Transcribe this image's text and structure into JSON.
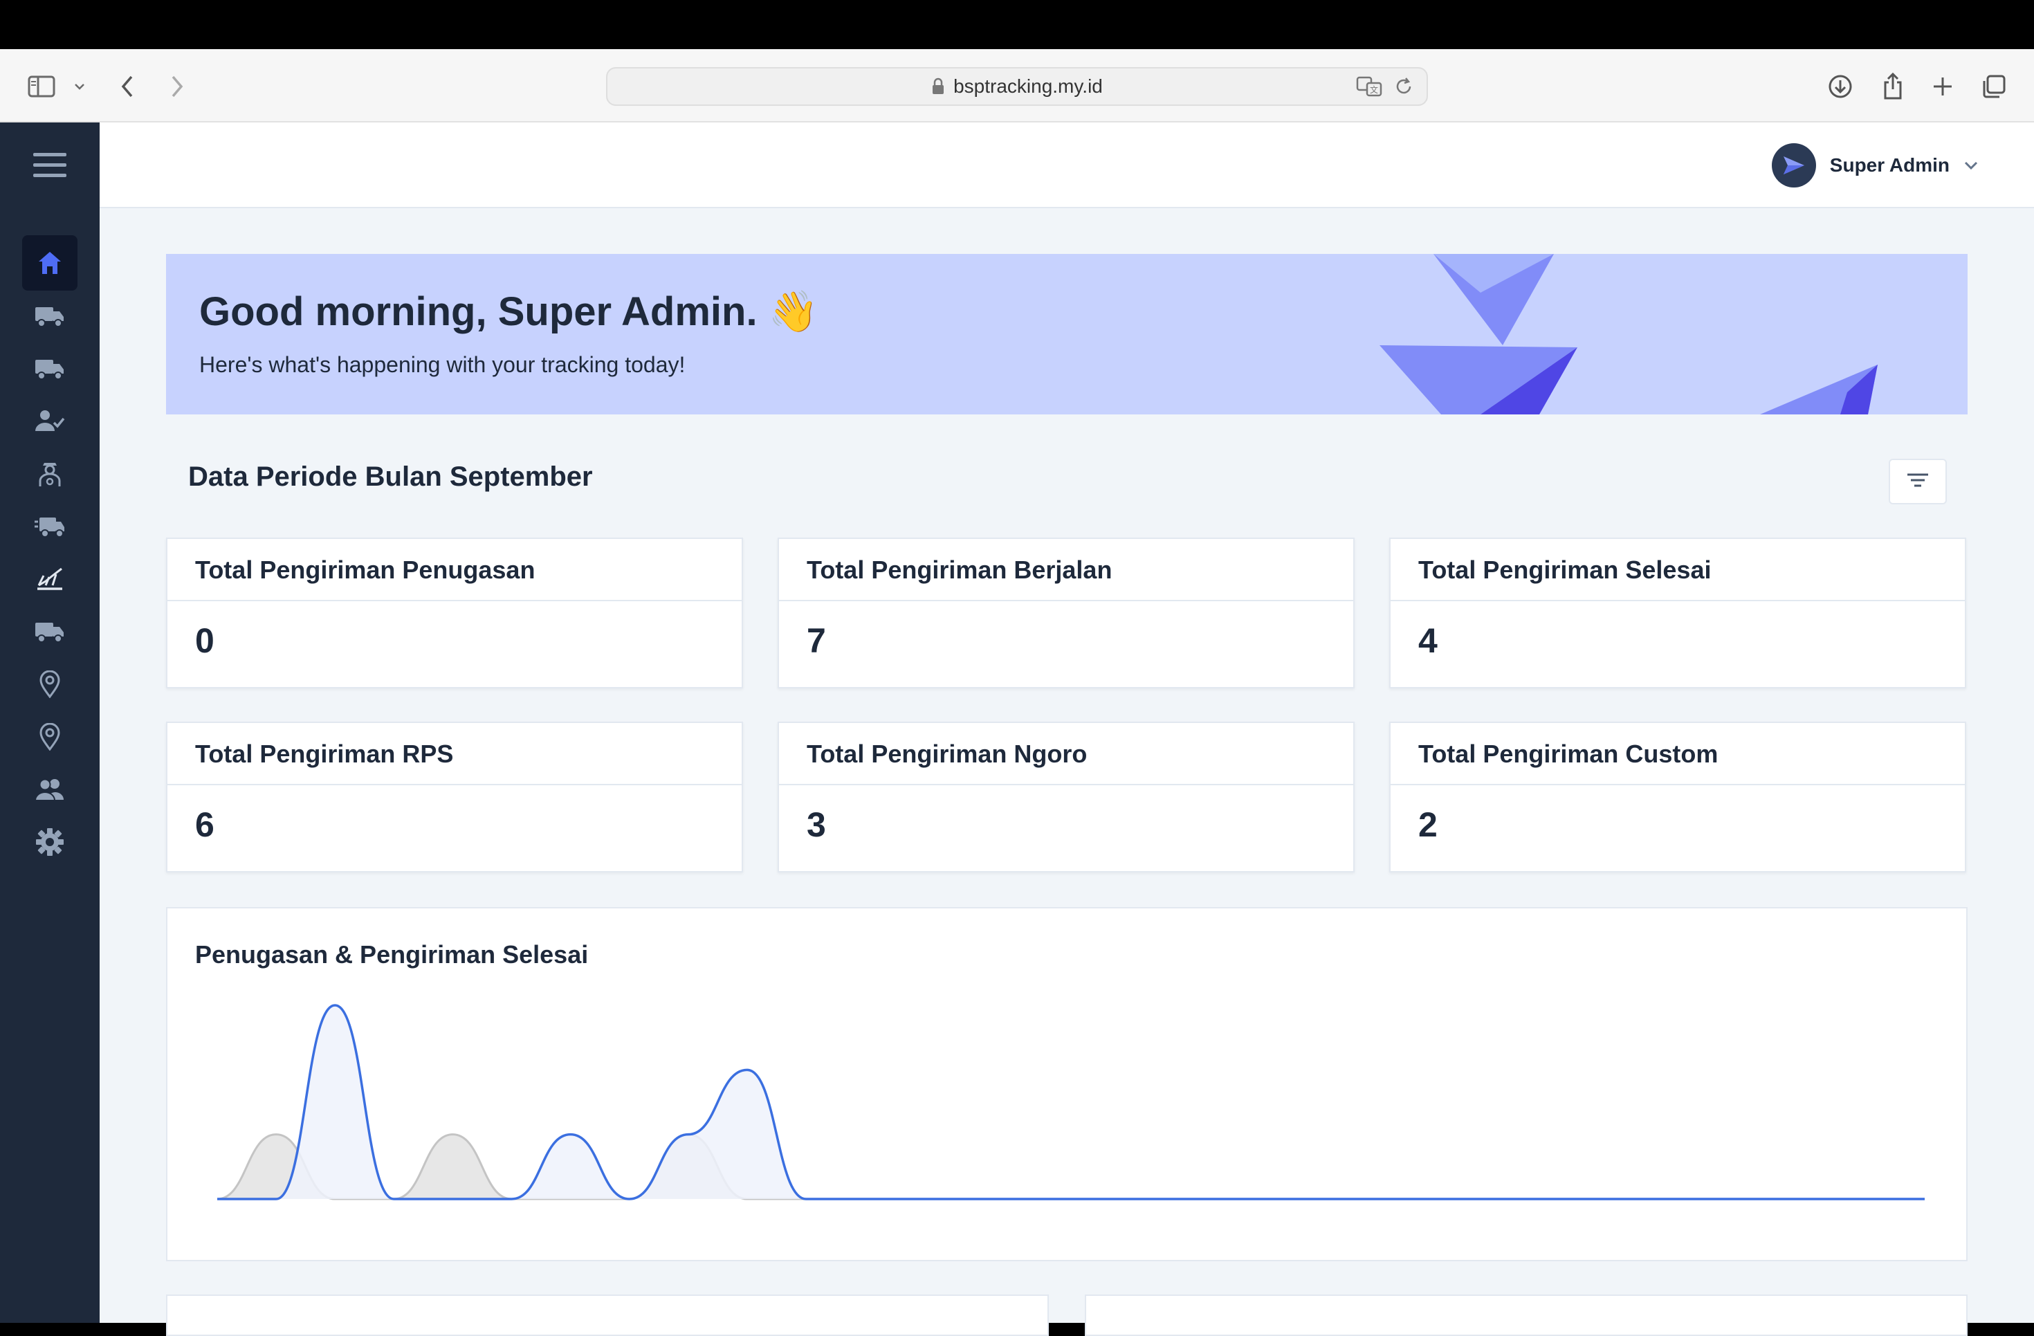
{
  "browser": {
    "url": "bsptracking.my.id"
  },
  "header": {
    "username": "Super Admin"
  },
  "sidebar": {
    "items": [
      {
        "icon": "menu-icon"
      },
      {
        "icon": "home-icon",
        "active": true
      },
      {
        "icon": "truck-icon"
      },
      {
        "icon": "truck-icon"
      },
      {
        "icon": "user-check-icon"
      },
      {
        "icon": "driver-icon"
      },
      {
        "icon": "fast-truck-icon"
      },
      {
        "icon": "chart-icon"
      },
      {
        "icon": "delivery-truck-icon"
      },
      {
        "icon": "location-pin-icon"
      },
      {
        "icon": "location-pin-icon"
      },
      {
        "icon": "users-icon"
      },
      {
        "icon": "gear-icon"
      }
    ]
  },
  "welcome": {
    "greeting": "Good morning, Super Admin. 👋",
    "subtitle": "Here's what's happening with your tracking today!"
  },
  "period": {
    "title": "Data Periode Bulan September"
  },
  "stats": [
    {
      "label": "Total Pengiriman Penugasan",
      "value": "0"
    },
    {
      "label": "Total Pengiriman Berjalan",
      "value": "7"
    },
    {
      "label": "Total Pengiriman Selesai",
      "value": "4"
    },
    {
      "label": "Total Pengiriman RPS",
      "value": "6"
    },
    {
      "label": "Total Pengiriman Ngoro",
      "value": "3"
    },
    {
      "label": "Total Pengiriman Custom",
      "value": "2"
    }
  ],
  "chart": {
    "title": "Penugasan & Pengiriman Selesai"
  },
  "chart_data": {
    "type": "area",
    "title": "Penugasan & Pengiriman Selesai",
    "xlabel": "",
    "ylabel": "",
    "grid": false,
    "x": [
      1,
      2,
      3,
      4,
      5,
      6,
      7,
      8,
      9,
      10,
      11,
      12,
      13,
      14,
      15,
      16,
      17,
      18,
      19,
      20,
      21,
      22,
      23,
      24,
      25,
      26,
      27,
      28,
      29,
      30
    ],
    "series": [
      {
        "color": "#3b6fe0",
        "fill": "#eef2fc",
        "values": [
          0,
          0,
          3,
          0,
          0,
          0,
          1,
          0,
          1,
          2,
          0,
          0,
          0,
          0,
          0,
          0,
          0,
          0,
          0,
          0,
          0,
          0,
          0,
          0,
          0,
          0,
          0,
          0,
          0,
          0
        ]
      },
      {
        "color": "#c4c4c4",
        "fill": "#e3e3e3",
        "values": [
          0,
          1,
          0,
          0,
          1,
          0,
          0,
          0,
          1,
          0,
          0,
          0,
          0,
          0,
          0,
          0,
          0,
          0,
          0,
          0,
          0,
          0,
          0,
          0,
          0,
          0,
          0,
          0,
          0,
          0
        ]
      }
    ],
    "ylim": [
      0,
      3
    ]
  },
  "colors": {
    "sidebar": "#1e293b",
    "accent": "#4f6df5",
    "banner": "#c7d2fe"
  }
}
